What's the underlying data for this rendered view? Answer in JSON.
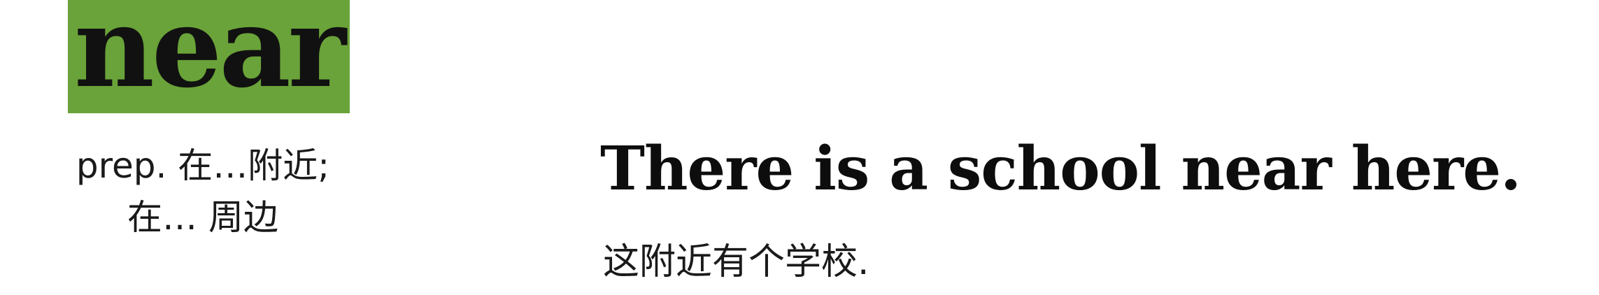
{
  "vocab": {
    "word": "near",
    "highlight_color": "#6aa339",
    "definition_line1": "prep. 在…附近;",
    "definition_line2": "在… 周边"
  },
  "example": {
    "sentence": "There is a school near here.",
    "translation": "这附近有个学校."
  }
}
